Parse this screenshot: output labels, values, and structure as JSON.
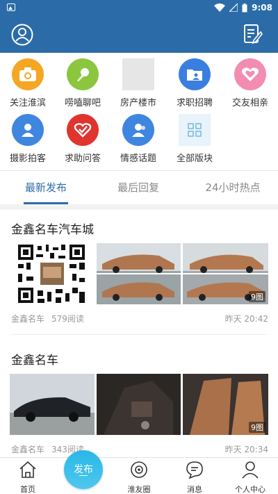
{
  "status_bar": {
    "time": "9:08"
  },
  "categories": [
    {
      "label": "关注淮滨",
      "icon": "camera-icon",
      "color": "#f5a623"
    },
    {
      "label": "唠嗑聊吧",
      "icon": "microphone-icon",
      "color": "#8cc63f"
    },
    {
      "label": "房产楼市",
      "icon": "placeholder-icon",
      "color": "#e6e6e6"
    },
    {
      "label": "求职招聘",
      "icon": "folder-user-icon",
      "color": "#3a7ee0"
    },
    {
      "label": "交友相亲",
      "icon": "heart-icon",
      "color": "#f28cb1"
    },
    {
      "label": "摄影拍客",
      "icon": "user-icon",
      "color": "#3f86e0"
    },
    {
      "label": "求助问答",
      "icon": "heart-check-icon",
      "color": "#e0342e"
    },
    {
      "label": "情感话题",
      "icon": "users-icon",
      "color": "#3f86e0"
    },
    {
      "label": "全部版块",
      "icon": "grid-icon",
      "color": "#e8f3fb"
    }
  ],
  "tabs": [
    {
      "label": "最新发布"
    },
    {
      "label": "最后回复"
    },
    {
      "label": "24小时热点"
    }
  ],
  "posts": [
    {
      "title": "金鑫名车汽车城",
      "author": "金鑫名车",
      "reads": "579阅读",
      "time": "昨天 20:42",
      "image_count": "9图"
    },
    {
      "title": "金鑫名车",
      "author": "金鑫名车",
      "reads": "343阅读",
      "time": "昨天 20:34",
      "image_count": "9图"
    }
  ],
  "bottom_nav": {
    "home": "首页",
    "publish": "发布",
    "circle": "淮友圈",
    "messages": "消息",
    "profile": "个人中心"
  },
  "colors": {
    "primary": "#2b6ca8",
    "publish": "#2fb9e9"
  }
}
